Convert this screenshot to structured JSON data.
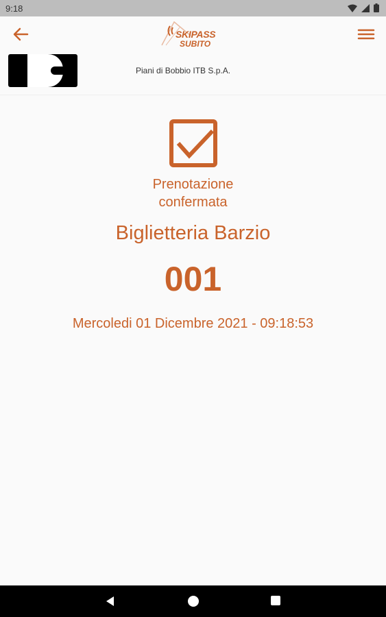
{
  "status_bar": {
    "time": "9:18",
    "icons": [
      "wifi-icon",
      "signal-icon",
      "battery-icon"
    ]
  },
  "header": {
    "logo": {
      "line1": "SKIPASS",
      "line2": "SUBITO"
    },
    "company_name": "Piani di Bobbio ITB S.p.A."
  },
  "confirmation": {
    "icon": "checkbox-checked-icon",
    "label_line1": "Prenotazione",
    "label_line2": "confermata",
    "office": "Biglietteria Barzio",
    "number": "001",
    "datetime": "Mercoledi 01 Dicembre 2021 - 09:18:53"
  },
  "colors": {
    "accent": "#c9632b",
    "status_bar": "#bdbdbd",
    "background": "#fafafa",
    "nav_bar": "#000000"
  },
  "nav_bar": {
    "icons": [
      "back-icon",
      "home-icon",
      "recents-icon"
    ]
  }
}
